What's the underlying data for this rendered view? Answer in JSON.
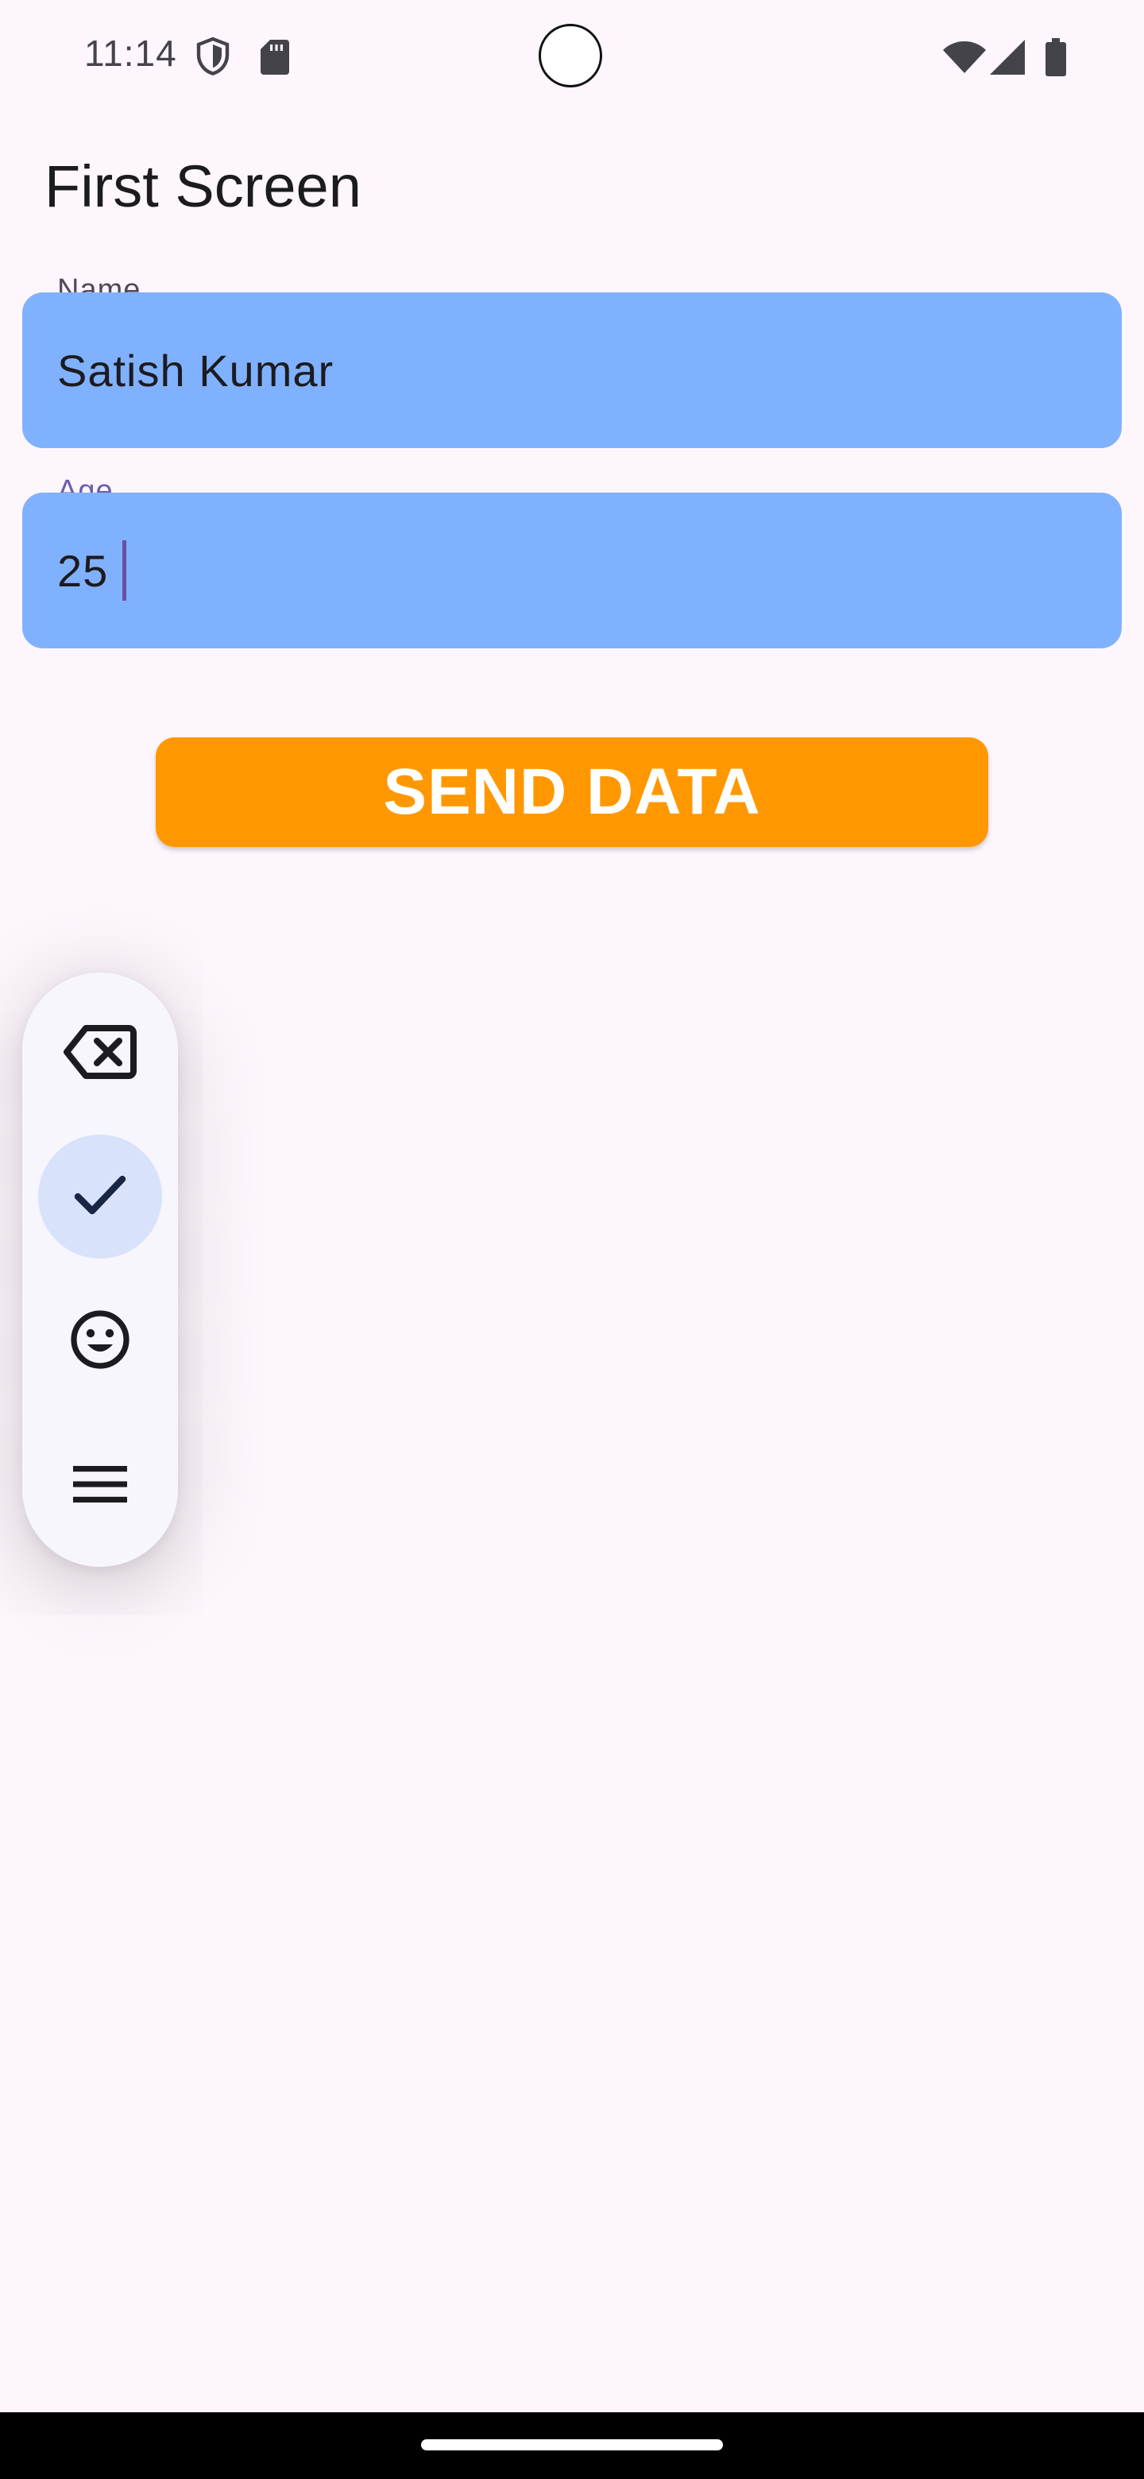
{
  "status_bar": {
    "time": "11:14",
    "left_icons": [
      "shield-icon",
      "sd-card-icon"
    ],
    "right_icons": [
      "wifi-icon",
      "cell-signal-icon",
      "battery-icon"
    ]
  },
  "screen": {
    "title": "First Screen"
  },
  "form": {
    "name_field": {
      "label": "Name",
      "value": "Satish Kumar"
    },
    "age_field": {
      "label": "Age",
      "value": "25",
      "focused": true
    },
    "send_button_label": "SEND DATA"
  },
  "floating_toolbar": {
    "items": [
      {
        "icon": "backspace-icon",
        "selected": false
      },
      {
        "icon": "check-icon",
        "selected": true
      },
      {
        "icon": "emoji-icon",
        "selected": false
      },
      {
        "icon": "menu-icon",
        "selected": false
      }
    ]
  },
  "colors": {
    "background": "#fdf6fd",
    "field_fill": "#80b1fe",
    "button_fill": "#ff9800",
    "caret": "#6750a4",
    "toolbar_selected": "#d8e2fb"
  }
}
